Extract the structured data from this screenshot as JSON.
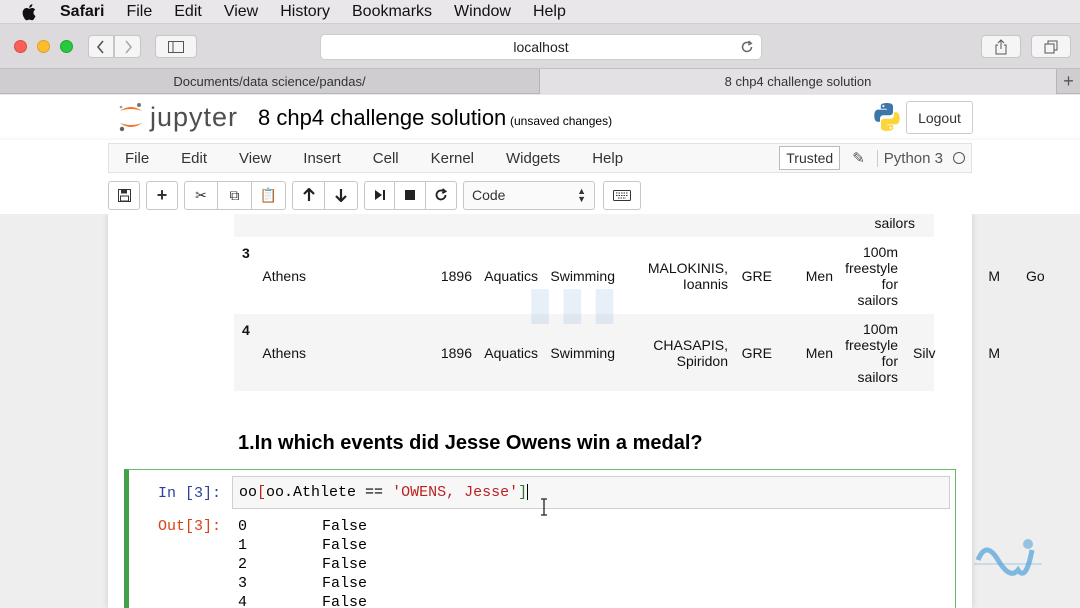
{
  "menubar": {
    "app": "Safari",
    "items": [
      "File",
      "Edit",
      "View",
      "History",
      "Bookmarks",
      "Window",
      "Help"
    ]
  },
  "browser": {
    "url": "localhost",
    "tabs": [
      {
        "label": "Documents/data science/pandas/"
      },
      {
        "label": "8 chp4 challenge solution"
      }
    ],
    "new_tab": "+"
  },
  "jupyter": {
    "logo_text": "jupyter",
    "notebook_title": "8 chp4 challenge solution",
    "save_status": "(unsaved changes)",
    "logout": "Logout",
    "menu": [
      "File",
      "Edit",
      "View",
      "Insert",
      "Cell",
      "Kernel",
      "Widgets",
      "Help"
    ],
    "trusted": "Trusted",
    "kernel": "Python 3",
    "cell_type": "Code"
  },
  "dataframe": {
    "partial_row": {
      "event": "sailors"
    },
    "rows": [
      {
        "index": "3",
        "city": "Athens",
        "year": "1896",
        "sport": "Aquatics",
        "discipline": "Swimming",
        "athlete_1": "MALOKINIS,",
        "athlete_2": "Ioannis",
        "country": "GRE",
        "gender": "Men",
        "event_1": "100m",
        "event_2": "freestyle",
        "event_3": "for",
        "event_4": "sailors",
        "event_gender": "M",
        "medal": "Go"
      },
      {
        "index": "4",
        "city": "Athens",
        "year": "1896",
        "sport": "Aquatics",
        "discipline": "Swimming",
        "athlete_1": "CHASAPIS,",
        "athlete_2": "Spiridon",
        "country": "GRE",
        "gender": "Men",
        "event_1": "100m",
        "event_2": "freestyle",
        "event_3": "for",
        "event_4": "sailors",
        "event_gender": "M",
        "medal": "Silv"
      }
    ]
  },
  "markdown_heading": "1.In which events did Jesse Owens win a medal?",
  "code_cell": {
    "in_prompt": "In [3]:",
    "code_prefix": "oo",
    "code_bracket_open": "[",
    "code_mid": "oo.Athlete == ",
    "code_string": "'OWENS, Jesse'",
    "code_bracket_close": "]",
    "out_prompt": "Out[3]:",
    "output": [
      {
        "index": "0",
        "value": "False"
      },
      {
        "index": "1",
        "value": "False"
      },
      {
        "index": "2",
        "value": "False"
      },
      {
        "index": "3",
        "value": "False"
      },
      {
        "index": "4",
        "value": "False"
      }
    ]
  },
  "colors": {
    "accent_green": "#42a047",
    "prompt_in": "#303f9f",
    "prompt_out": "#d84315",
    "string": "#ba2121"
  }
}
